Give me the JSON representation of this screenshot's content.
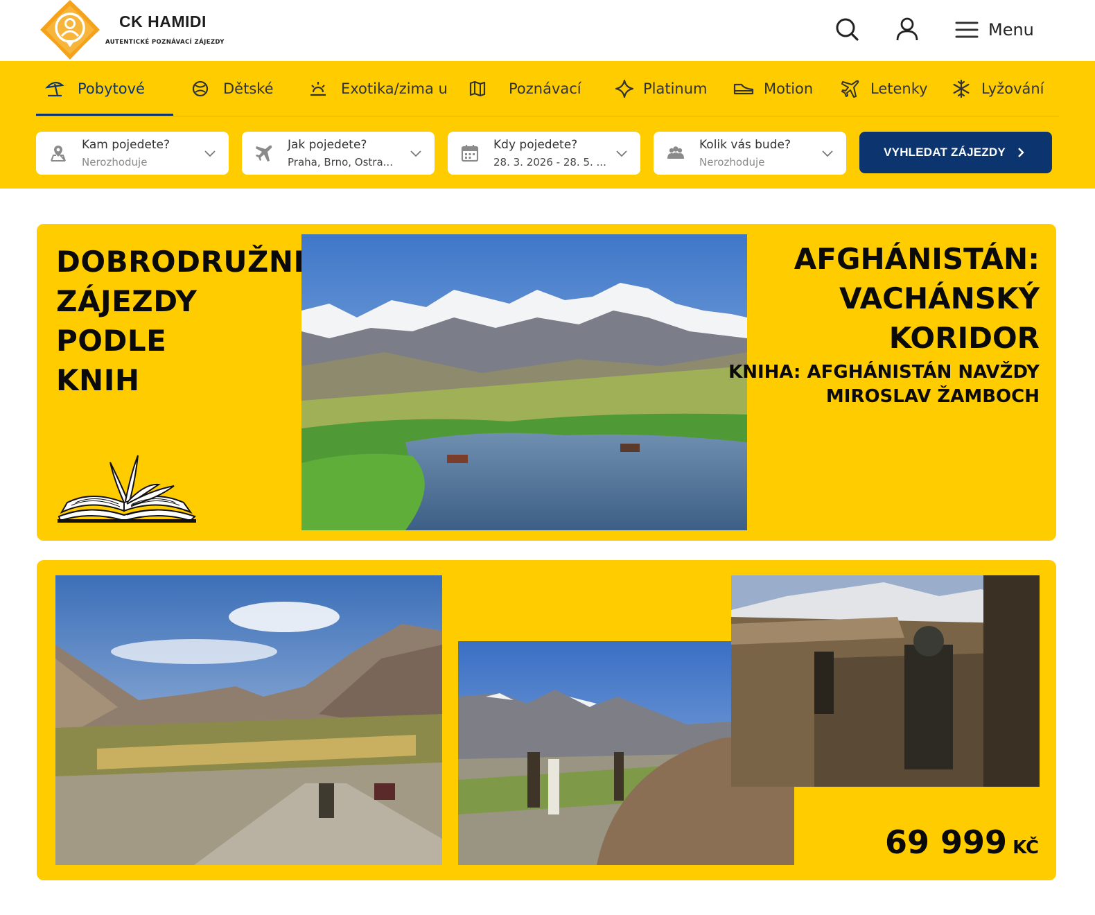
{
  "brand": {
    "name": "CK HAMIDI",
    "tagline": "AUTENTICKÉ POZNÁVACÍ ZÁJEZDY",
    "colors": {
      "primary_yellow": "#ffcc00",
      "logo_orange": "#f5a21a",
      "navy": "#0c3570"
    }
  },
  "header": {
    "search_icon": "search-icon",
    "account_icon": "user-icon",
    "menu_label": "Menu"
  },
  "nav": {
    "tabs": [
      {
        "label": "Pobytové",
        "icon": "beach-umbrella-icon",
        "active": true
      },
      {
        "label": "Dětské",
        "icon": "ball-icon"
      },
      {
        "label": "Exotika/zima u",
        "icon": "sun-icon"
      },
      {
        "label": "Poznávací",
        "icon": "map-icon"
      },
      {
        "label": "Platinum",
        "icon": "sparkle-icon"
      },
      {
        "label": "Motion",
        "icon": "sneaker-icon"
      },
      {
        "label": "Letenky",
        "icon": "plane-icon"
      },
      {
        "label": "Lyžování",
        "icon": "snowflake-icon"
      }
    ]
  },
  "search": {
    "fields": [
      {
        "label": "Kam pojedete?",
        "value": "Nerozhoduje",
        "icon": "map-pin-icon"
      },
      {
        "label": "Jak pojedete?",
        "value": "Praha, Brno, Ostra...",
        "icon": "plane-icon"
      },
      {
        "label": "Kdy pojedete?",
        "value": "28. 3. 2026 - 28. 5. ...",
        "icon": "calendar-icon"
      },
      {
        "label": "Kolik vás bude?",
        "value": "Nerozhoduje",
        "icon": "people-icon"
      }
    ],
    "button_label": "VYHLEDAT ZÁJEZDY"
  },
  "banner1": {
    "title_lines": [
      "DOBRODRUŽNÉ",
      "ZÁJEZDY",
      "PODLE",
      "KNIH"
    ],
    "destination_lines": [
      "AFGHÁNISTÁN:",
      "VACHÁNSKÝ",
      "KORIDOR"
    ],
    "book_lines": [
      "KNIHA: AFGHÁNISTÁN NAVŽDY",
      "MIROSLAV ŽAMBOCH"
    ],
    "illustration": "open-book-icon"
  },
  "banner2": {
    "price": "69 999",
    "currency": "KČ"
  }
}
